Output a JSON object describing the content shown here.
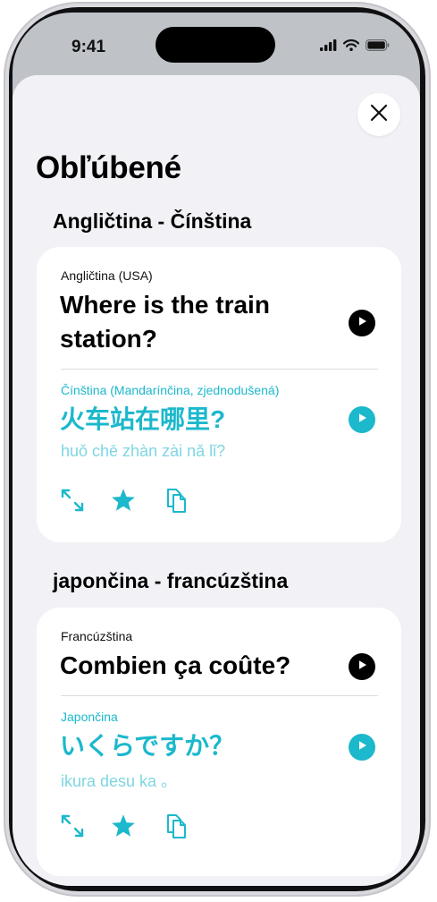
{
  "status": {
    "time": "9:41"
  },
  "page": {
    "title": "Obľúbené"
  },
  "sections": [
    {
      "title": "Angličtina - Čínština",
      "source_lang": "Angličtina (USA)",
      "source_text": "Where is the train station?",
      "target_lang": "Čínština (Mandarínčina, zjednodušená)",
      "target_text": "火车站在哪里?",
      "romanization": "huǒ chē zhàn zài nǎ lǐ?"
    },
    {
      "title": "japončina - francúzština",
      "source_lang": "Francúzština",
      "source_text": "Combien ça coûte?",
      "target_lang": "Japončina",
      "target_text": "いくらですか？",
      "romanization": "ikura desu ka 。"
    }
  ],
  "icons": {
    "close": "close-icon",
    "play": "play-icon",
    "expand": "expand-icon",
    "favorite": "star-icon",
    "copy": "copy-icon",
    "signal": "cellular-signal-icon",
    "wifi": "wifi-icon",
    "battery": "battery-icon"
  },
  "colors": {
    "accent": "#1cb8cc",
    "romanization": "#7fd6e2",
    "sheet_background": "#f2f2f6"
  }
}
